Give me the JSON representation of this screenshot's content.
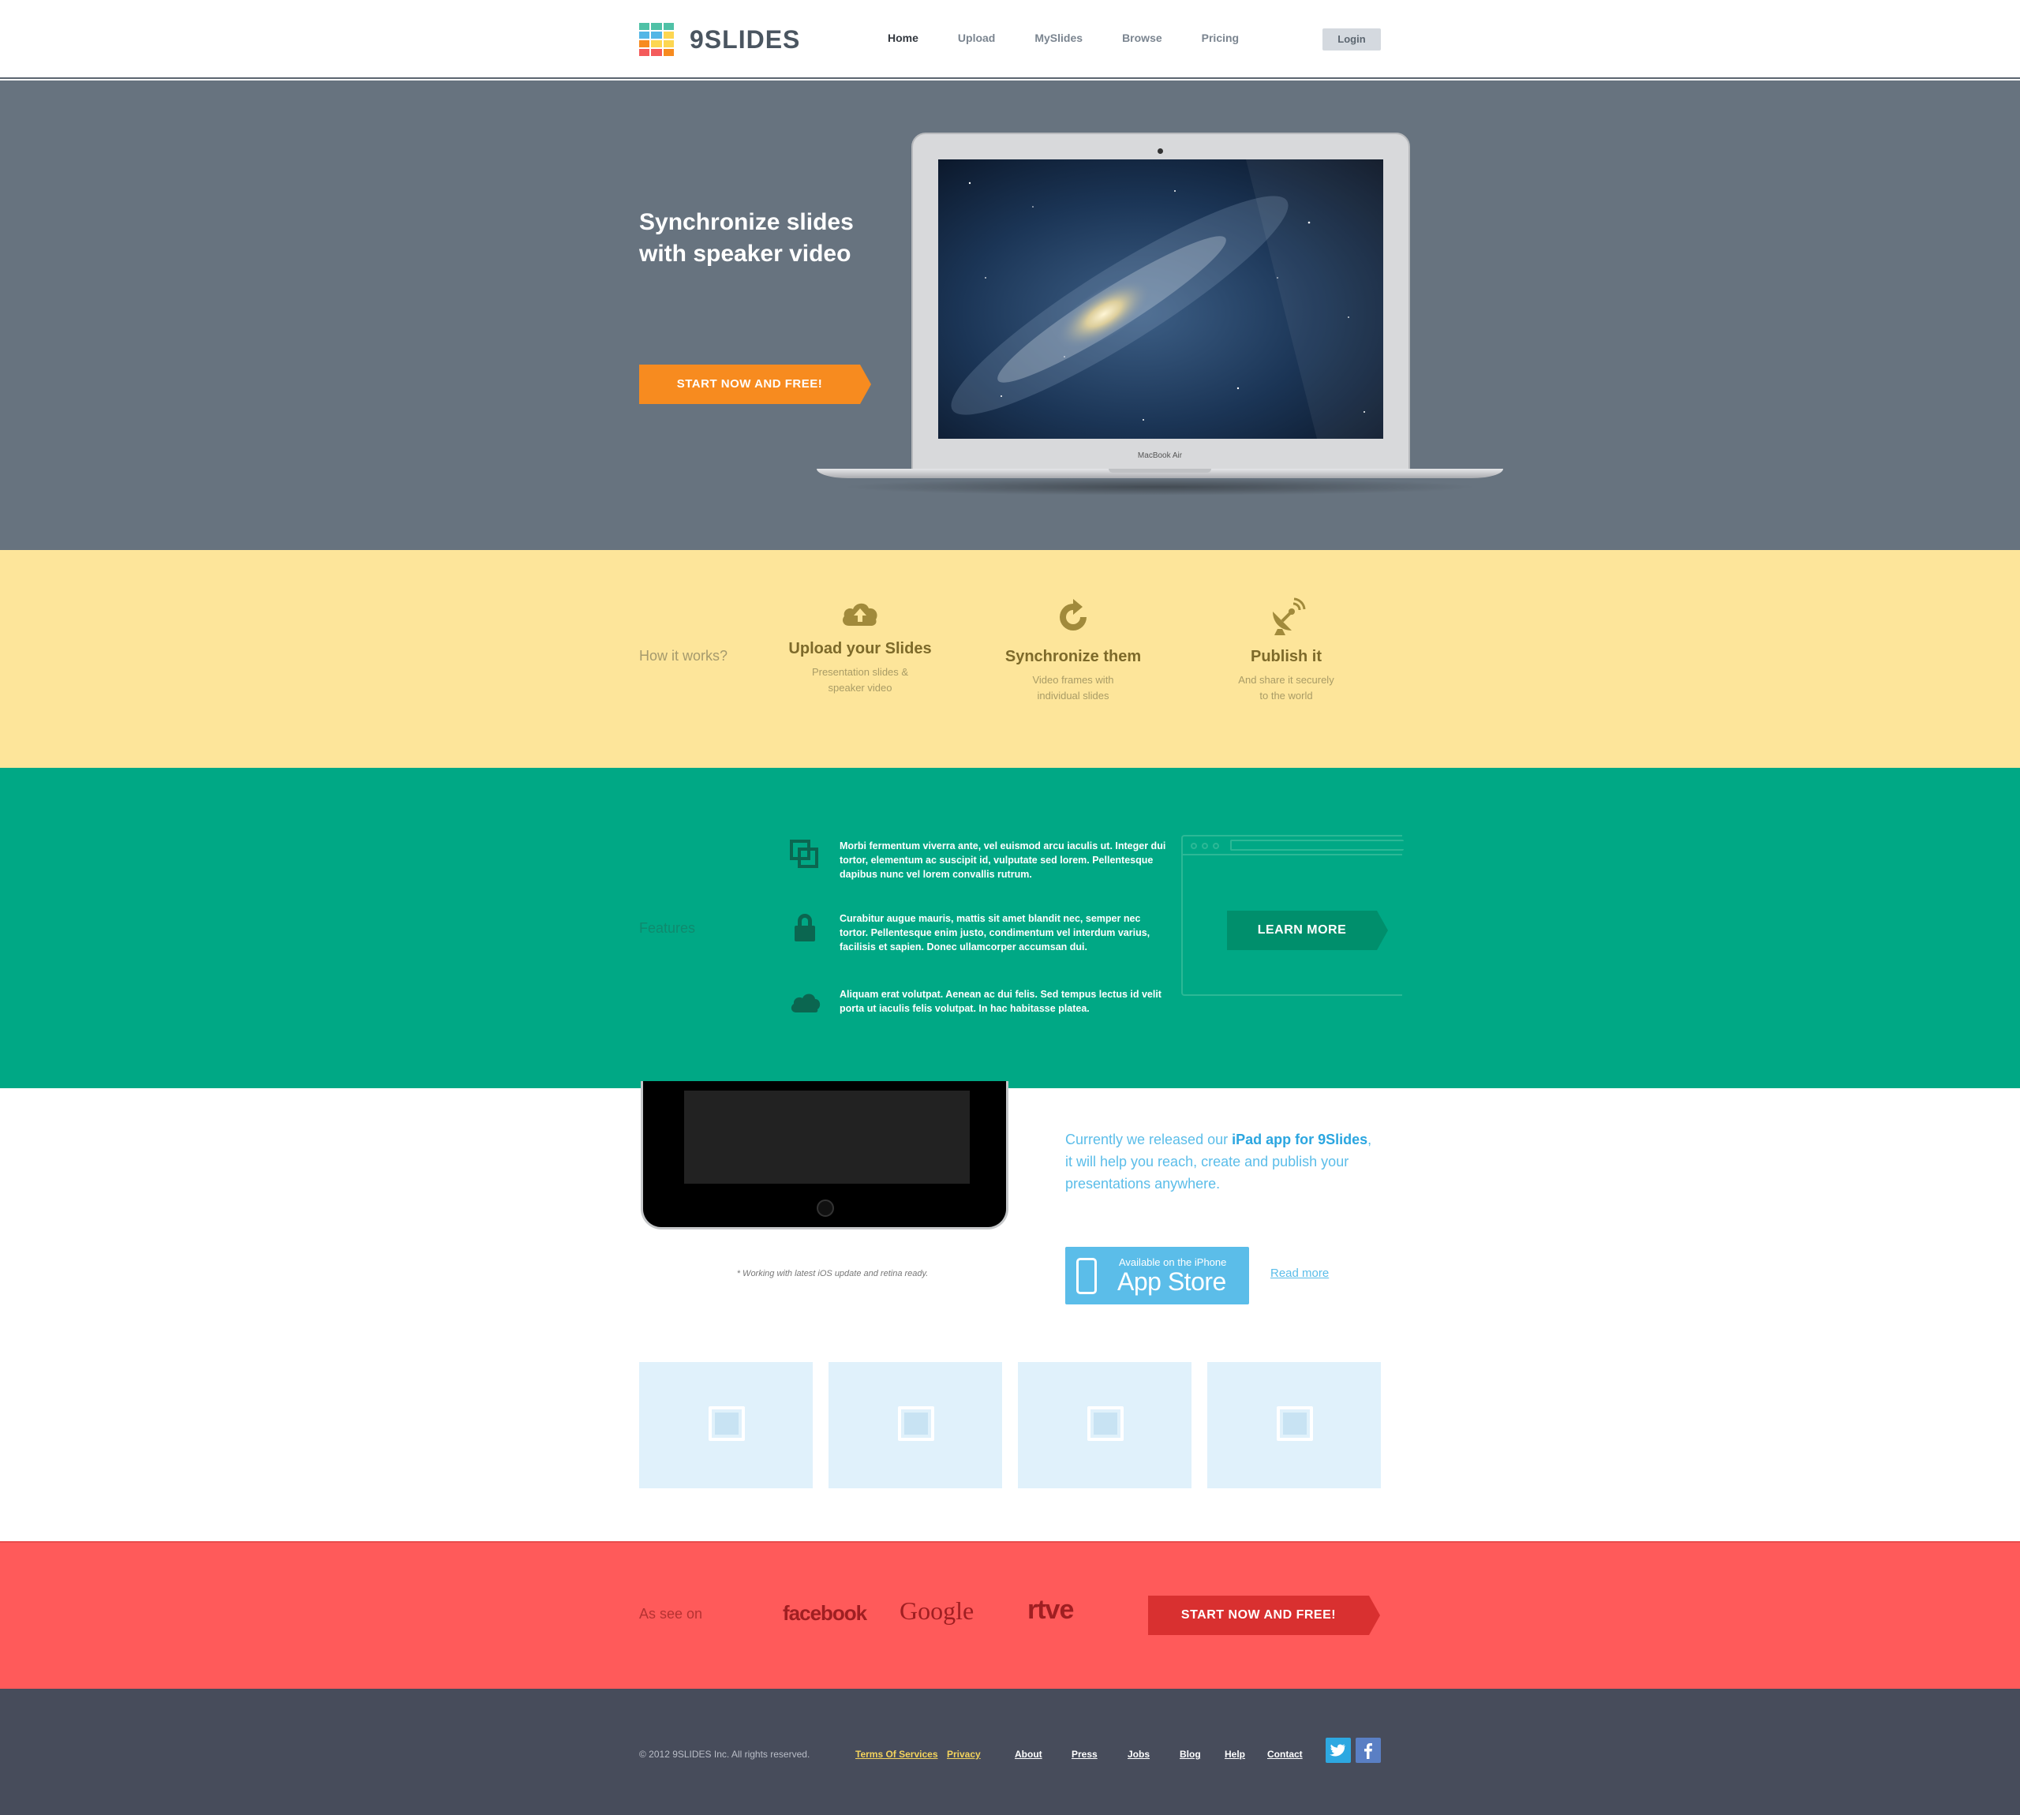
{
  "header": {
    "brand": "9SLIDES",
    "nav": [
      "Home",
      "Upload",
      "MySlides",
      "Browse",
      "Pricing"
    ],
    "active_nav": "Home",
    "login_label": "Login"
  },
  "hero": {
    "title": "Synchronize slides with speaker video",
    "cta_label": "START NOW AND FREE!",
    "laptop_label": "MacBook Air"
  },
  "how": {
    "label": "How it works?",
    "steps": [
      {
        "icon": "cloud-upload-icon",
        "title": "Upload your Slides",
        "desc": "Presentation slides &\nspeaker video"
      },
      {
        "icon": "refresh-icon",
        "title": "Synchronize them",
        "desc": "Video frames with\nindividual slides"
      },
      {
        "icon": "satellite-dish-icon",
        "title": "Publish it",
        "desc": "And share it securely\nto the world"
      }
    ]
  },
  "features": {
    "label": "Features",
    "items": [
      {
        "icon": "copy-icon",
        "text": "Morbi fermentum viverra ante, vel euismod arcu iaculis ut. Integer dui tortor, elementum ac suscipit id, vulputate sed lorem. Pellentesque dapibus nunc vel lorem convallis rutrum."
      },
      {
        "icon": "lock-icon",
        "text": "Curabitur augue mauris, mattis sit amet blandit nec, semper nec tortor. Pellentesque enim justo, condimentum vel interdum varius, facilisis et sapien. Donec ullamcorper accumsan dui."
      },
      {
        "icon": "cloud-icon",
        "text": "Aliquam erat volutpat. Aenean ac dui felis. Sed tempus lectus id velit porta ut iaculis felis volutpat. In hac habitasse platea."
      }
    ],
    "learn_more_label": "LEARN MORE"
  },
  "ipad": {
    "text_before": "Currently we released our ",
    "text_highlight": "iPad app for 9Slides",
    "text_after": ", it will help you reach, create and publish your presentations anywhere.",
    "note": "* Working with latest iOS update and retina ready.",
    "appstore_small": "Available on the iPhone",
    "appstore_big": "App Store",
    "read_more": "Read more"
  },
  "thumbnails": [
    "image-icon",
    "image-icon",
    "image-icon",
    "image-icon"
  ],
  "press": {
    "label": "As see on",
    "brands": [
      "facebook",
      "Google",
      "rtve"
    ],
    "cta_label": "START NOW AND FREE!"
  },
  "footer": {
    "copyright": "© 2012 9SLIDES Inc. All rights reserved.",
    "legal": [
      "Terms Of Services",
      "Privacy"
    ],
    "links": [
      "About",
      "Press",
      "Jobs",
      "Blog",
      "Help",
      "Contact"
    ],
    "social": [
      "twitter-icon",
      "facebook-icon"
    ]
  },
  "colors": {
    "hero_bg": "#67737f",
    "how_bg": "#fde59a",
    "features_bg": "#00a885",
    "press_bg": "#ff5a5a",
    "footer_bg": "#474c5b",
    "cta_orange": "#f78b1f",
    "accent_blue": "#5bbde9"
  }
}
